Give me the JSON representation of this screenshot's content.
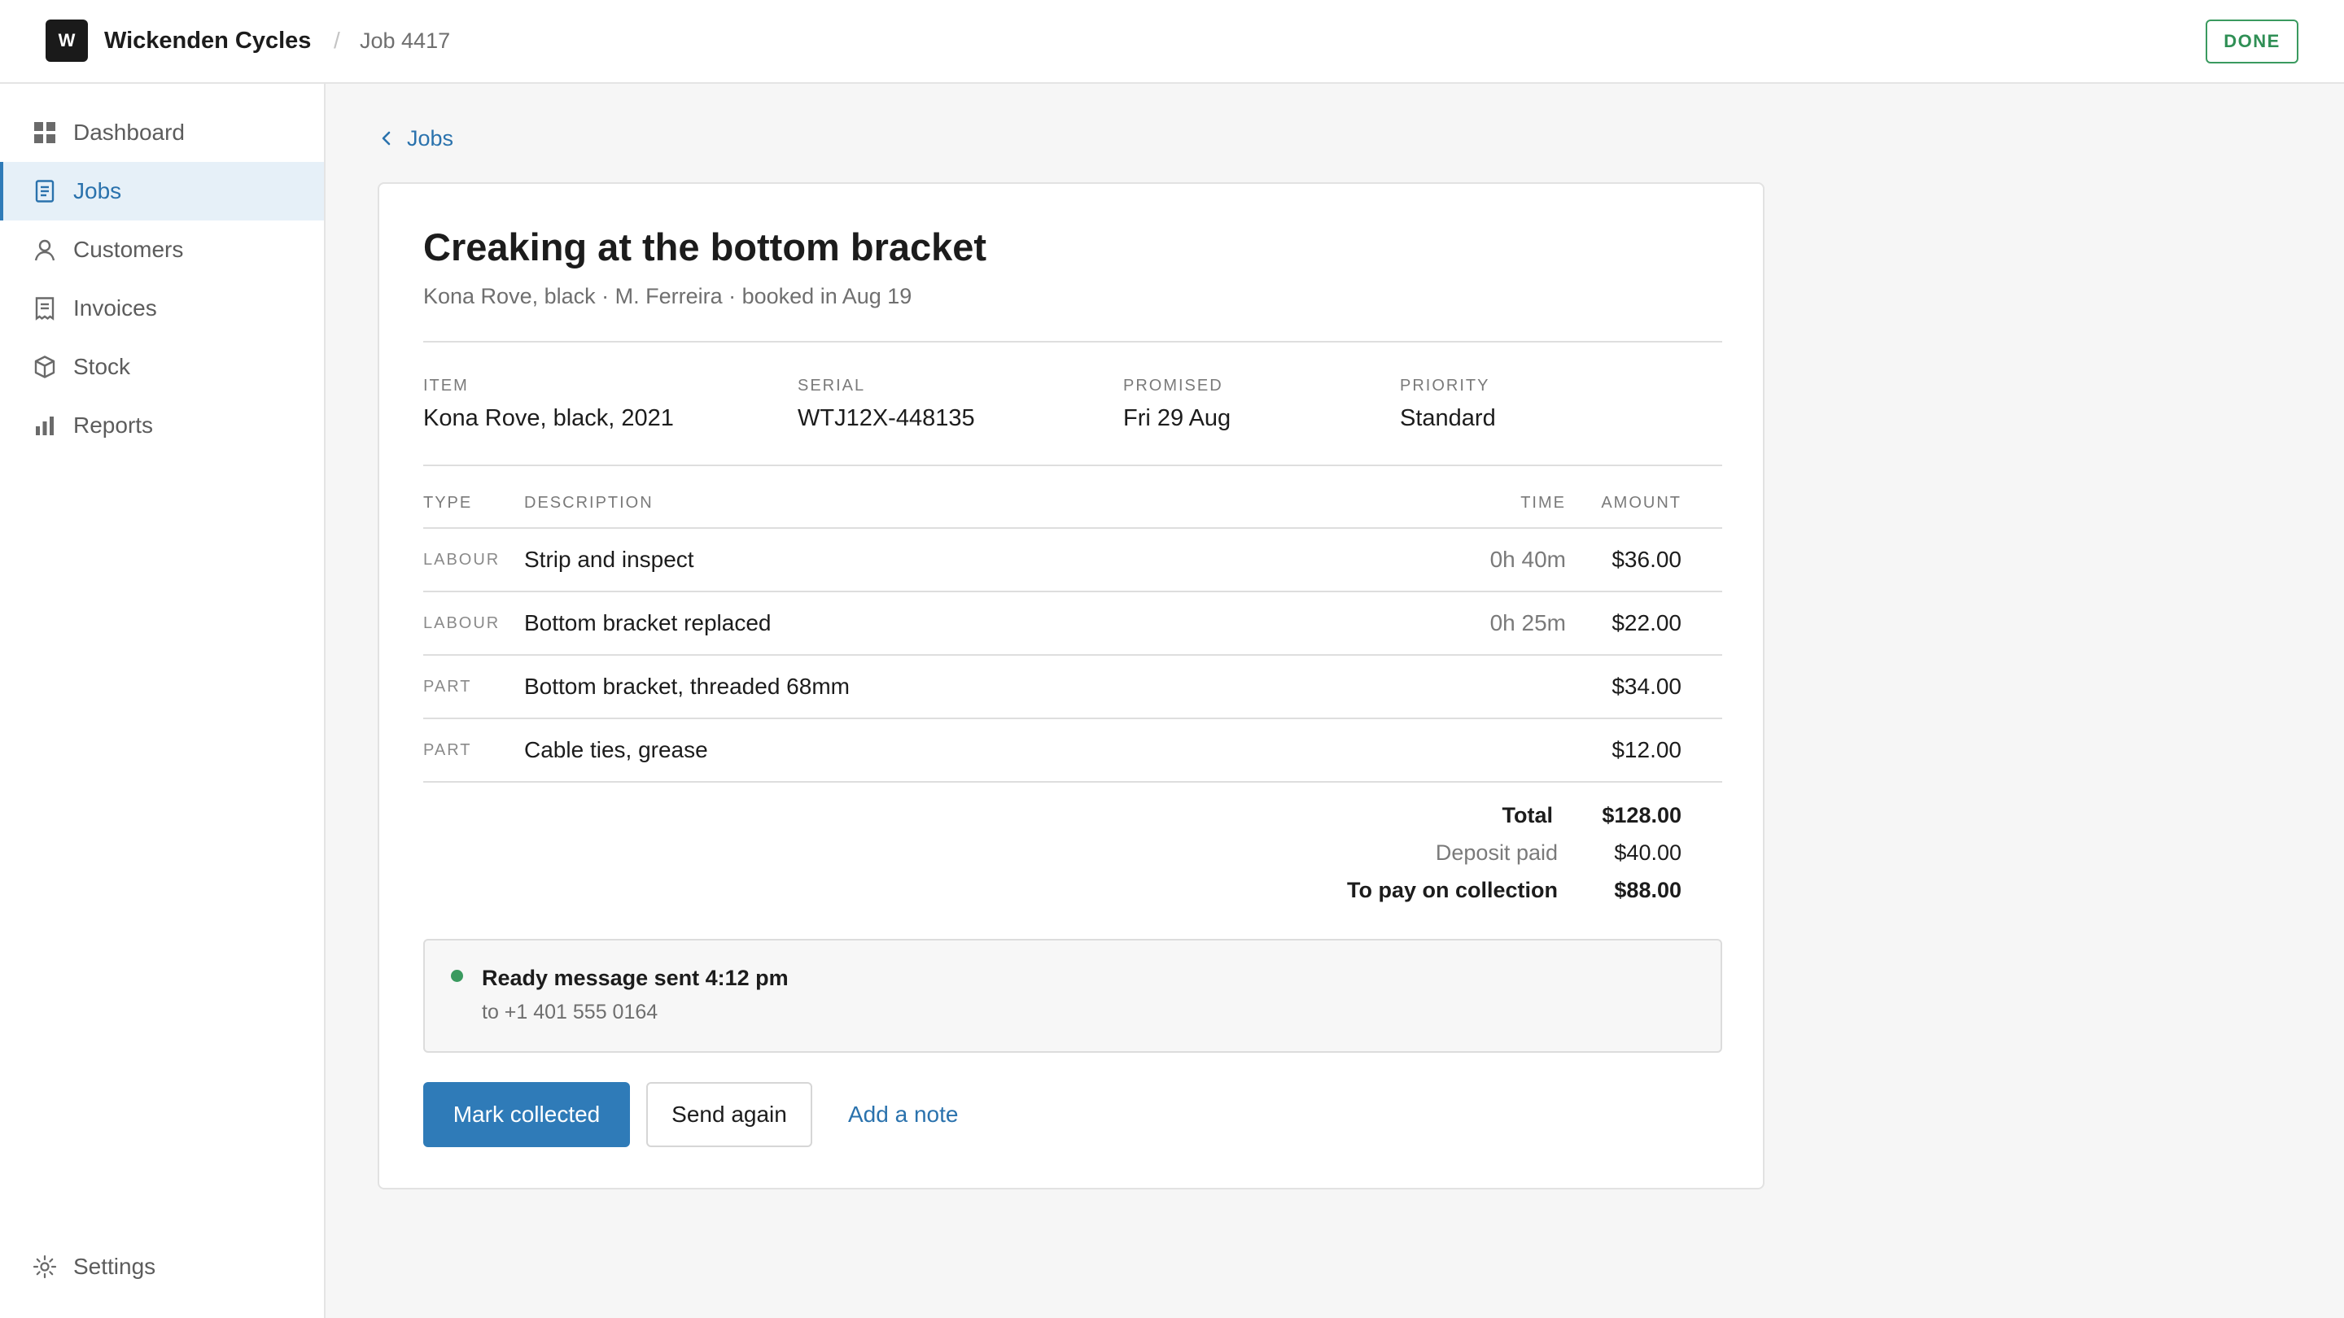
{
  "header": {
    "logo_letter": "W",
    "app_name": "Wickenden Cycles",
    "separator": "/",
    "job_crumb": "Job 4417",
    "done_label": "DONE"
  },
  "sidebar": {
    "items": [
      {
        "label": "Dashboard",
        "icon": "dashboard-icon"
      },
      {
        "label": "Jobs",
        "icon": "jobs-icon",
        "active": true
      },
      {
        "label": "Customers",
        "icon": "customers-icon"
      },
      {
        "label": "Invoices",
        "icon": "invoices-icon"
      },
      {
        "label": "Stock",
        "icon": "stock-icon"
      },
      {
        "label": "Reports",
        "icon": "reports-icon"
      }
    ],
    "settings": {
      "label": "Settings",
      "icon": "settings-icon"
    }
  },
  "main": {
    "back_label": "Jobs",
    "title": "Creaking at the bottom bracket",
    "subtitle": "Kona Rove, black · M. Ferreira · booked in Aug 19",
    "meta": [
      {
        "label": "ITEM",
        "value": "Kona Rove, black, 2021"
      },
      {
        "label": "SERIAL",
        "value": "WTJ12X-448135"
      },
      {
        "label": "PROMISED",
        "value": "Fri 29 Aug"
      },
      {
        "label": "PRIORITY",
        "value": "Standard"
      }
    ],
    "table": {
      "headers": {
        "type": "TYPE",
        "description": "DESCRIPTION",
        "time": "TIME",
        "amount": "AMOUNT"
      },
      "rows": [
        {
          "type": "LABOUR",
          "description": "Strip and inspect",
          "time": "0h 40m",
          "amount": "$36.00"
        },
        {
          "type": "LABOUR",
          "description": "Bottom bracket replaced",
          "time": "0h 25m",
          "amount": "$22.00"
        },
        {
          "type": "PART",
          "description": "Bottom bracket, threaded 68mm",
          "time": "",
          "amount": "$34.00"
        },
        {
          "type": "PART",
          "description": "Cable ties, grease",
          "time": "",
          "amount": "$12.00"
        }
      ]
    },
    "totals": {
      "total_label": "Total",
      "total_value": "$128.00",
      "deposit_label": "Deposit paid",
      "deposit_value": "$40.00",
      "due_label": "To pay on collection",
      "due_value": "$88.00"
    },
    "notice": {
      "title": "Ready message sent 4:12 pm",
      "subtitle": "to +1 401 555 0164",
      "status_color": "#3a9a5f"
    },
    "actions": {
      "primary": "Mark collected",
      "secondary": "Send again",
      "link": "Add a note"
    }
  },
  "colors": {
    "accent": "#2f7bb8",
    "success": "#3a9a5f",
    "active_nav_bg": "#e6f0f8"
  }
}
